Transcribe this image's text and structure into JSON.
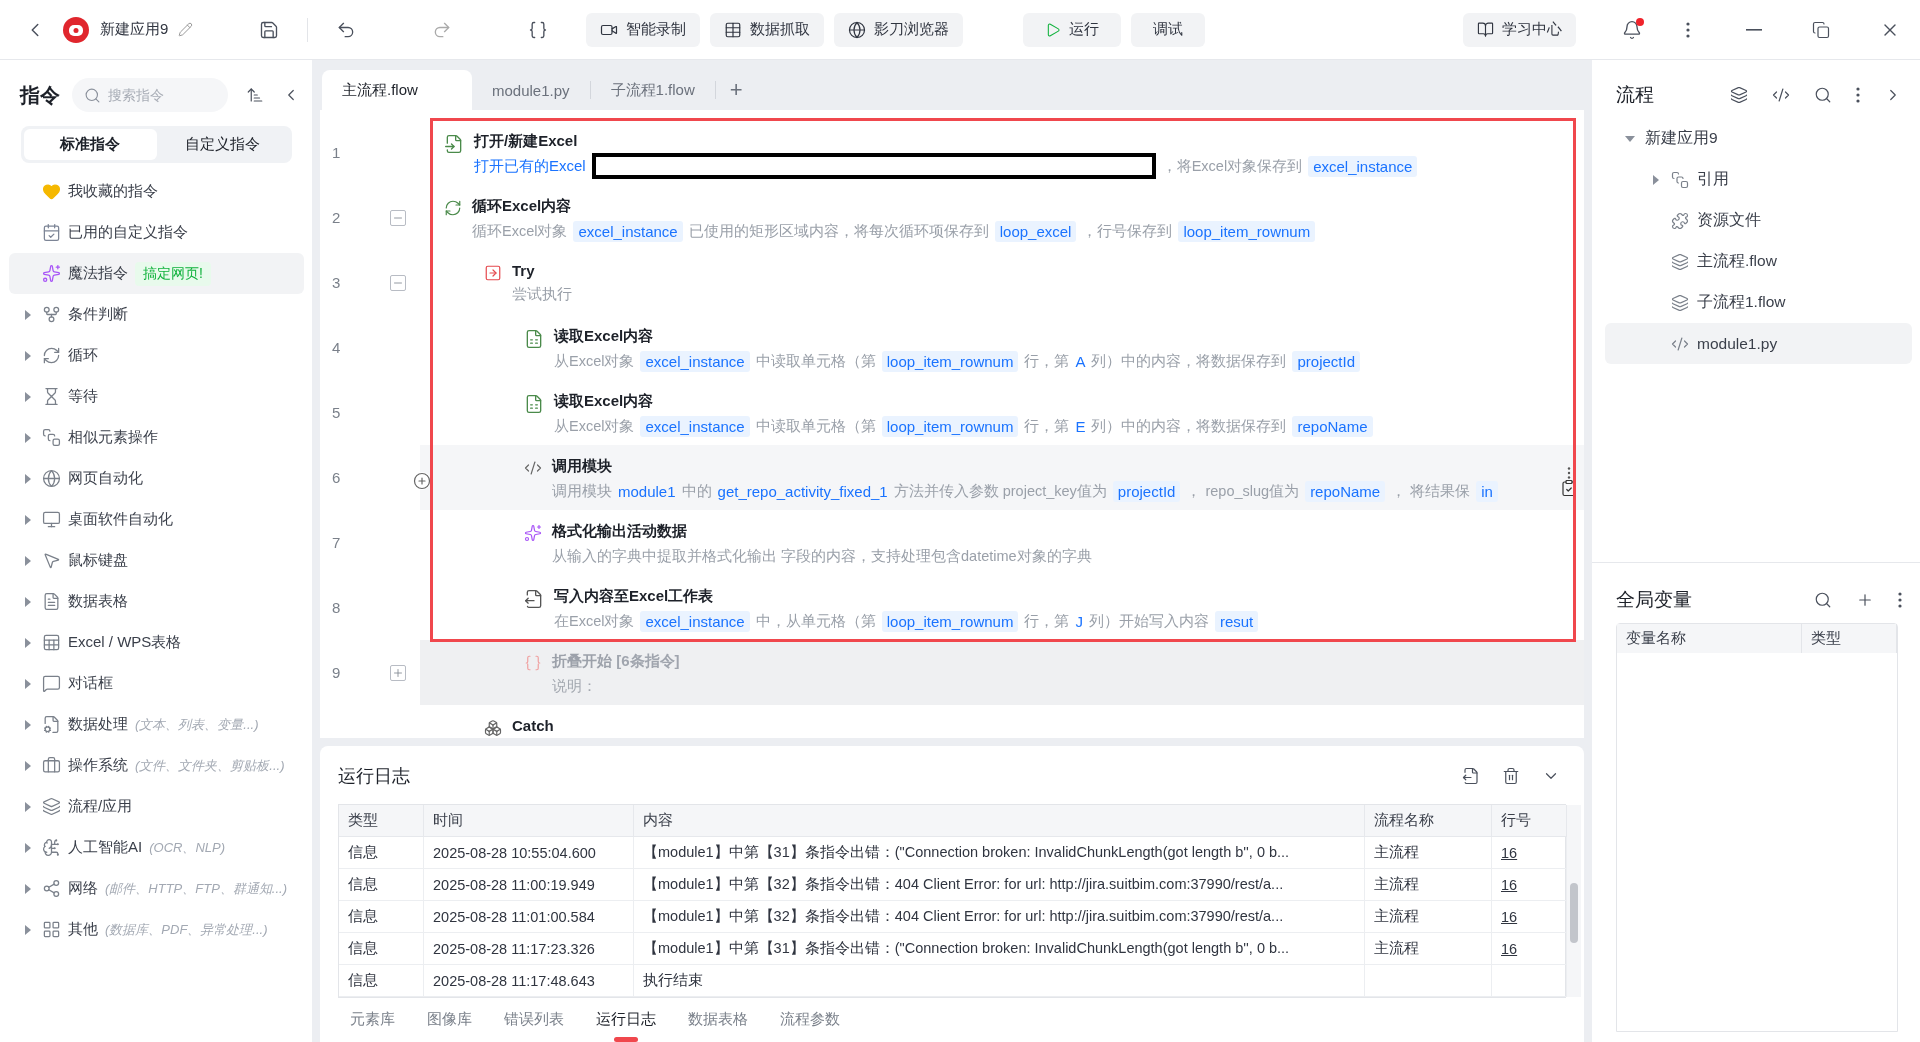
{
  "topbar": {
    "app_name": "新建应用9",
    "tools": [
      {
        "label": "智能录制"
      },
      {
        "label": "数据抓取"
      },
      {
        "label": "影刀浏览器"
      }
    ],
    "run_buttons": [
      {
        "label": "运行"
      },
      {
        "label": "调试"
      }
    ],
    "learn_center": "学习中心",
    "notification": {
      "unread": true
    }
  },
  "sidebar": {
    "title": "指令",
    "search": {
      "placeholder": "搜索指令"
    },
    "tabs": [
      {
        "label": "标准指令",
        "selected": true
      },
      {
        "label": "自定义指令",
        "selected": false
      }
    ],
    "items": [
      {
        "label": "我收藏的指令",
        "selected": false
      },
      {
        "label": "已用的自定义指令",
        "selected": false
      },
      {
        "label": "魔法指令",
        "badge": "搞定网页!",
        "selected": true
      },
      {
        "label": "条件判断",
        "expanded": false,
        "selected": false
      },
      {
        "label": "循环",
        "expanded": false,
        "selected": false
      },
      {
        "label": "等待",
        "expanded": false,
        "selected": false
      },
      {
        "label": "相似元素操作",
        "expanded": false,
        "selected": false
      },
      {
        "label": "网页自动化",
        "expanded": false,
        "selected": false
      },
      {
        "label": "桌面软件自动化",
        "expanded": false,
        "selected": false
      },
      {
        "label": "鼠标键盘",
        "expanded": false,
        "selected": false
      },
      {
        "label": "数据表格",
        "expanded": false,
        "selected": false
      },
      {
        "label": "Excel / WPS表格",
        "expanded": false,
        "selected": false
      },
      {
        "label": "对话框",
        "expanded": false,
        "selected": false
      },
      {
        "label": "数据处理",
        "hint": "(文本、列表、变量...)",
        "expanded": false,
        "selected": false
      },
      {
        "label": "操作系统",
        "hint": "(文件、文件夹、剪贴板...)",
        "expanded": false,
        "selected": false
      },
      {
        "label": "流程/应用",
        "expanded": false,
        "selected": false
      },
      {
        "label": "人工智能AI",
        "hint": "(OCR、NLP)",
        "expanded": false,
        "selected": false
      },
      {
        "label": "网络",
        "hint": "(邮件、HTTP、FTP、群通知...)",
        "expanded": false,
        "selected": false
      },
      {
        "label": "其他",
        "hint": "(数据库、PDF、异常处理...)",
        "expanded": false,
        "selected": false
      }
    ]
  },
  "editor": {
    "tabs": [
      {
        "label": "主流程.flow",
        "selected": true
      },
      {
        "label": "module1.py",
        "selected": false
      },
      {
        "label": "子流程1.flow",
        "selected": false
      }
    ],
    "add_tab": "+",
    "annotation": {
      "kind": "box"
    },
    "steps": [
      {
        "line": "1",
        "kind": "open",
        "title": "打开/新建Excel",
        "hovered": false,
        "disabled": false,
        "parts": [
          {
            "kind": "link",
            "text": "打开已有的Excel"
          },
          {
            "kind": "redacted"
          },
          {
            "kind": "text",
            "text": "，将Excel对象保存到"
          },
          {
            "kind": "var",
            "text": "excel_instance"
          }
        ]
      },
      {
        "line": "2",
        "kind": "loop",
        "title": "循环Excel内容",
        "hovered": false,
        "disabled": false,
        "expanded": true,
        "parts": [
          {
            "kind": "text",
            "text": "循环Excel对象"
          },
          {
            "kind": "var",
            "text": "excel_instance"
          },
          {
            "kind": "text",
            "text": "已使用的矩形区域内容，将每次循环项保存到"
          },
          {
            "kind": "var",
            "text": "loop_excel"
          },
          {
            "kind": "text",
            "text": "，行号保存到"
          },
          {
            "kind": "var",
            "text": "loop_item_rownum"
          }
        ],
        "children": [
          {
            "line": "3",
            "kind": "try",
            "title": "Try",
            "hovered": false,
            "disabled": false,
            "expanded": true,
            "parts": [
              {
                "kind": "text",
                "text": "尝试执行"
              }
            ],
            "children": [
              {
                "line": "4",
                "kind": "read",
                "title": "读取Excel内容",
                "hovered": false,
                "disabled": false,
                "parts": [
                  {
                    "kind": "text",
                    "text": "从Excel对象"
                  },
                  {
                    "kind": "var",
                    "text": "excel_instance"
                  },
                  {
                    "kind": "text",
                    "text": "中读取单元格（第"
                  },
                  {
                    "kind": "var",
                    "text": "loop_item_rownum"
                  },
                  {
                    "kind": "text",
                    "text": "行，第"
                  },
                  {
                    "kind": "link",
                    "text": "A"
                  },
                  {
                    "kind": "text",
                    "text": "列）中的内容，将数据保存到"
                  },
                  {
                    "kind": "var",
                    "text": "projectId"
                  }
                ]
              },
              {
                "line": "5",
                "kind": "read",
                "title": "读取Excel内容",
                "hovered": false,
                "disabled": false,
                "parts": [
                  {
                    "kind": "text",
                    "text": "从Excel对象"
                  },
                  {
                    "kind": "var",
                    "text": "excel_instance"
                  },
                  {
                    "kind": "text",
                    "text": "中读取单元格（第"
                  },
                  {
                    "kind": "var",
                    "text": "loop_item_rownum"
                  },
                  {
                    "kind": "text",
                    "text": "行，第"
                  },
                  {
                    "kind": "link",
                    "text": "E"
                  },
                  {
                    "kind": "text",
                    "text": "列）中的内容，将数据保存到"
                  },
                  {
                    "kind": "var",
                    "text": "repoName"
                  }
                ]
              },
              {
                "line": "6",
                "kind": "call",
                "title": "调用模块",
                "hovered": true,
                "disabled": false,
                "parts": [
                  {
                    "kind": "text",
                    "text": "调用模块"
                  },
                  {
                    "kind": "link",
                    "text": "module1"
                  },
                  {
                    "kind": "text",
                    "text": "中的"
                  },
                  {
                    "kind": "link",
                    "text": "get_repo_activity_fixed_1"
                  },
                  {
                    "kind": "text",
                    "text": "方法并传入参数 project_key值为"
                  },
                  {
                    "kind": "var",
                    "text": "projectId"
                  },
                  {
                    "kind": "text",
                    "text": "，  repo_slug值为"
                  },
                  {
                    "kind": "var",
                    "text": "repoName"
                  },
                  {
                    "kind": "text",
                    "text": "，  将结果保"
                  },
                  {
                    "kind": "var",
                    "text": "in"
                  }
                ]
              },
              {
                "line": "7",
                "kind": "format",
                "title": "格式化输出活动数据",
                "hovered": false,
                "disabled": false,
                "parts": [
                  {
                    "kind": "text",
                    "text": "从输入的字典中提取并格式化输出   字段的内容，支持处理包含datetime对象的字典"
                  }
                ]
              },
              {
                "line": "8",
                "kind": "write",
                "title": "写入内容至Excel工作表",
                "hovered": false,
                "disabled": false,
                "parts": [
                  {
                    "kind": "text",
                    "text": "在Excel对象"
                  },
                  {
                    "kind": "var",
                    "text": "excel_instance"
                  },
                  {
                    "kind": "text",
                    "text": "中，从单元格（第"
                  },
                  {
                    "kind": "var",
                    "text": "loop_item_rownum"
                  },
                  {
                    "kind": "text",
                    "text": "行，第"
                  },
                  {
                    "kind": "link",
                    "text": "J"
                  },
                  {
                    "kind": "text",
                    "text": "列）开始写入内容"
                  },
                  {
                    "kind": "var",
                    "text": "resut"
                  }
                ]
              },
              {
                "line": "9",
                "kind": "fold",
                "title": "折叠开始",
                "count": "[6条指令]",
                "hovered": false,
                "disabled": true,
                "expanded": false,
                "parts": [
                  {
                    "kind": "text",
                    "text": "说明："
                  }
                ]
              }
            ]
          },
          {
            "kind": "catch",
            "title": "Catch",
            "hovered": false,
            "disabled": false
          }
        ]
      }
    ]
  },
  "log": {
    "title": "运行日志",
    "columns": [
      "类型",
      "时间",
      "内容",
      "流程名称",
      "行号"
    ],
    "rows": [
      [
        "信息",
        "2025-08-28 10:55:04.600",
        "【module1】中第【31】条指令出错：(\"Connection broken: InvalidChunkLength(got length b'', 0 b...",
        "主流程",
        "16"
      ],
      [
        "信息",
        "2025-08-28 11:00:19.949",
        "【module1】中第【32】条指令出错：404 Client Error:  for url: http://jira.suitbim.com:37990/rest/a...",
        "主流程",
        "16"
      ],
      [
        "信息",
        "2025-08-28 11:01:00.584",
        "【module1】中第【32】条指令出错：404 Client Error:  for url: http://jira.suitbim.com:37990/rest/a...",
        "主流程",
        "16"
      ],
      [
        "信息",
        "2025-08-28 11:17:23.326",
        "【module1】中第【31】条指令出错：(\"Connection broken: InvalidChunkLength(got length b'', 0 b...",
        "主流程",
        "16"
      ],
      [
        "信息",
        "2025-08-28 11:17:48.643",
        "执行结束",
        "",
        ""
      ]
    ],
    "tabs": [
      {
        "label": "元素库",
        "selected": false
      },
      {
        "label": "图像库",
        "selected": false
      },
      {
        "label": "错误列表",
        "selected": false
      },
      {
        "label": "运行日志",
        "selected": true
      },
      {
        "label": "数据表格",
        "selected": false
      },
      {
        "label": "流程参数",
        "selected": false
      }
    ]
  },
  "flow_panel": {
    "title": "流程",
    "tree": [
      {
        "label": "新建应用9",
        "expanded": true,
        "selected": false,
        "children": [
          {
            "label": "引用",
            "expanded": false,
            "selected": false
          },
          {
            "label": "资源文件",
            "selected": false
          },
          {
            "label": "主流程.flow",
            "selected": false
          },
          {
            "label": "子流程1.flow",
            "selected": false
          },
          {
            "label": "module1.py",
            "selected": true
          }
        ]
      }
    ]
  },
  "globals_panel": {
    "title": "全局变量",
    "columns": [
      "变量名称",
      "类型"
    ]
  }
}
